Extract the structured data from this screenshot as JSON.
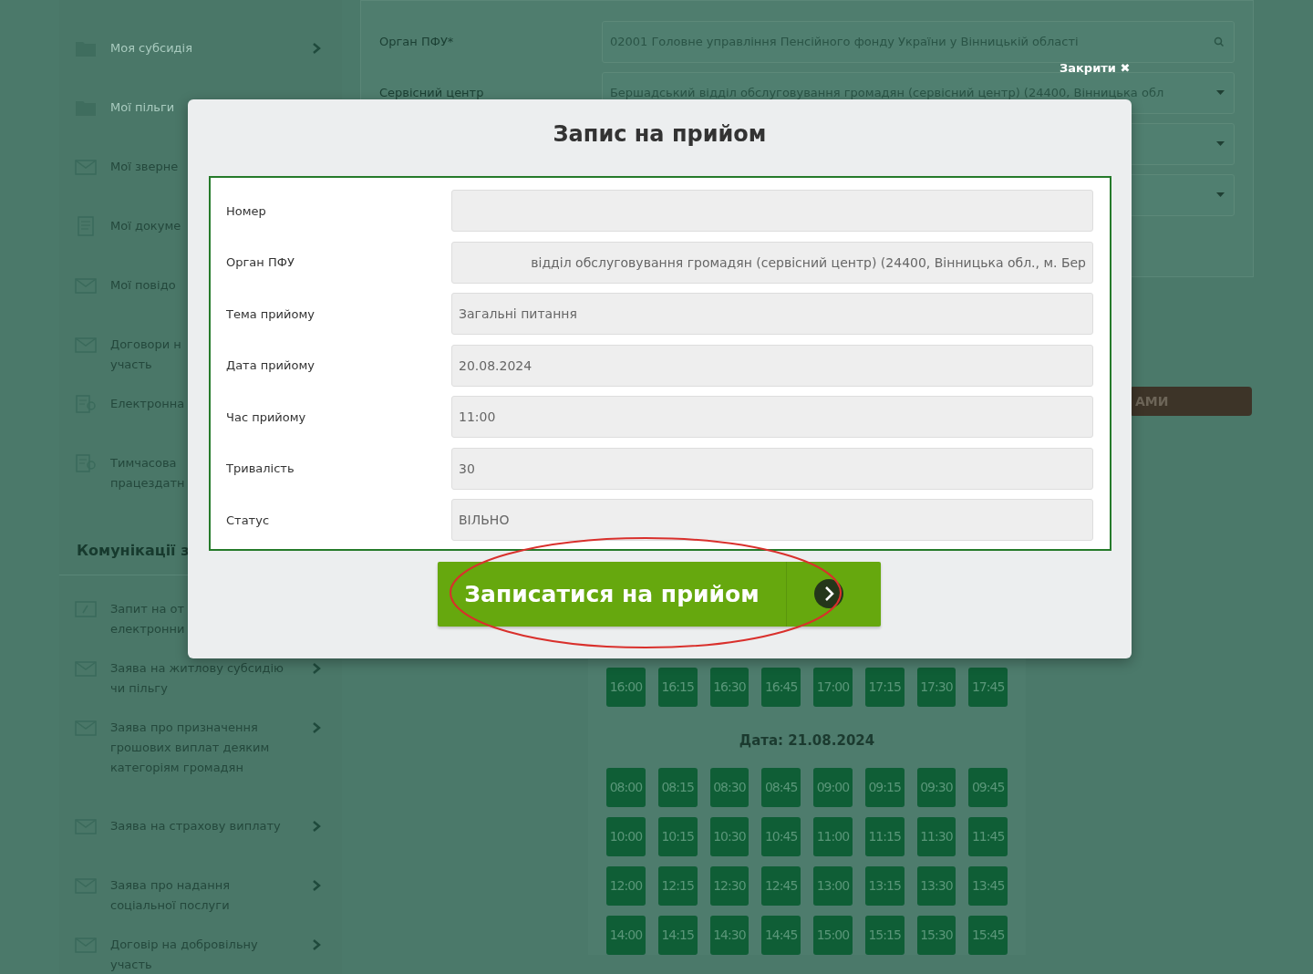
{
  "sidebar": {
    "groups": [
      {
        "items": [
          {
            "kind": "folder",
            "label": "Моя субсидія",
            "arrow": true,
            "dim": true
          },
          {
            "kind": "folder",
            "label": "Мої пільги",
            "dim": true
          },
          {
            "kind": "envelope",
            "label": "Мої зверне",
            "dim": false
          },
          {
            "kind": "document",
            "label": "Мої докуме",
            "dim": false
          },
          {
            "kind": "envelope",
            "label": "Мої повідо",
            "dim": false
          },
          {
            "kind": "envelope",
            "label": "Договори н\nучасть",
            "dim": false
          },
          {
            "kind": "certificate",
            "label": "Електронна",
            "dim": false
          },
          {
            "kind": "certificate",
            "label": "Тимчасова\nпрацездатн",
            "dim": false
          }
        ]
      },
      {
        "title": "Комунікації з",
        "items": [
          {
            "kind": "edit",
            "label": "Запит на от\nелектронни",
            "dim": false
          },
          {
            "kind": "envelope",
            "label": "Заява на житлову субсидію\nчи пільгу",
            "arrow": true,
            "dim": false
          },
          {
            "kind": "envelope",
            "label": "Заява про призначення\nгрошових виплат деяким\nкатегоріям громадян",
            "arrow": true,
            "dim": false
          },
          {
            "kind": "envelope",
            "label": "Заява на страхову виплату",
            "arrow": true,
            "dim": false
          },
          {
            "kind": "envelope",
            "label": "Заява про надання\nсоціальної послуги",
            "arrow": true,
            "dim": false
          },
          {
            "kind": "envelope",
            "label": "Договір на добровільну\nучасть",
            "arrow": true,
            "dim": false
          }
        ]
      }
    ]
  },
  "form": {
    "rows": [
      {
        "label": "Орган ПФУ*",
        "kind": "search",
        "value": "02001 Головне управління Пенсійного фонду України у Вінницькій області"
      },
      {
        "label": "Сервісний центр",
        "kind": "select",
        "value": "Бершадський відділ обслуговування громадян (сервісний центр) (24400, Вінницька обл"
      },
      {
        "kind": "select"
      },
      {
        "kind": "select"
      }
    ]
  },
  "dark_button": {
    "label": "АМИ"
  },
  "schedule": {
    "first_rows": [
      [
        "16:00",
        "16:15",
        "16:30",
        "16:45",
        "17:00",
        "17:15",
        "17:30",
        "17:45"
      ]
    ],
    "date_title": "Дата: 21.08.2024",
    "rows": [
      [
        "08:00",
        "08:15",
        "08:30",
        "08:45",
        "09:00",
        "09:15",
        "09:30",
        "09:45"
      ],
      [
        "10:00",
        "10:15",
        "10:30",
        "10:45",
        "11:00",
        "11:15",
        "11:30",
        "11:45"
      ],
      [
        "12:00",
        "12:15",
        "12:30",
        "12:45",
        "13:00",
        "13:15",
        "13:30",
        "13:45"
      ],
      [
        "14:00",
        "14:15",
        "14:30",
        "14:45",
        "15:00",
        "15:15",
        "15:30",
        "15:45"
      ]
    ]
  },
  "modal": {
    "close": "Закрити",
    "close_icon": "✖",
    "title": "Запис на прийом",
    "fields": [
      {
        "kind": "text",
        "label": "Номер"
      },
      {
        "kind": "scrolled",
        "label": "Орган ПФУ",
        "value": "відділ обслуговування громадян (сервісний центр) (24400, Вінницька обл., м. Бер"
      },
      {
        "kind": "text",
        "label": "Тема прийому",
        "value": "Загальні питання"
      },
      {
        "kind": "text",
        "label": "Дата прийому",
        "value": "20.08.2024"
      },
      {
        "kind": "text",
        "label": "Час прийому",
        "value": "11:00"
      },
      {
        "kind": "text",
        "label": "Тривалість",
        "value": "30"
      },
      {
        "kind": "text",
        "label": "Статус",
        "value": "ВІЛЬНО"
      }
    ],
    "submit": "Записатися на прийом",
    "highlighted": true
  }
}
